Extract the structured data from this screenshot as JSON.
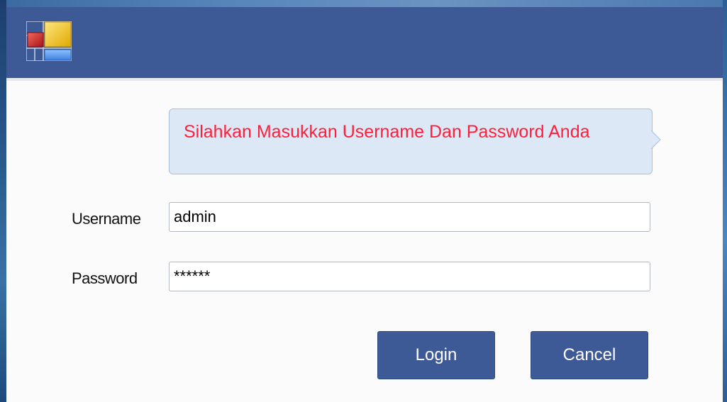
{
  "window": {
    "title_icon": "app-logo-icon"
  },
  "prompt": {
    "message": "Silahkan Masukkan Username Dan Password Anda"
  },
  "form": {
    "username_label": "Username",
    "username_value": "admin",
    "password_label": "Password",
    "password_value": "******"
  },
  "buttons": {
    "login_label": "Login",
    "cancel_label": "Cancel"
  },
  "colors": {
    "titlebar": "#3d5a96",
    "button": "#3d5a96",
    "message_text": "#ff1f3a",
    "balloon_bg": "#dde8f7"
  }
}
